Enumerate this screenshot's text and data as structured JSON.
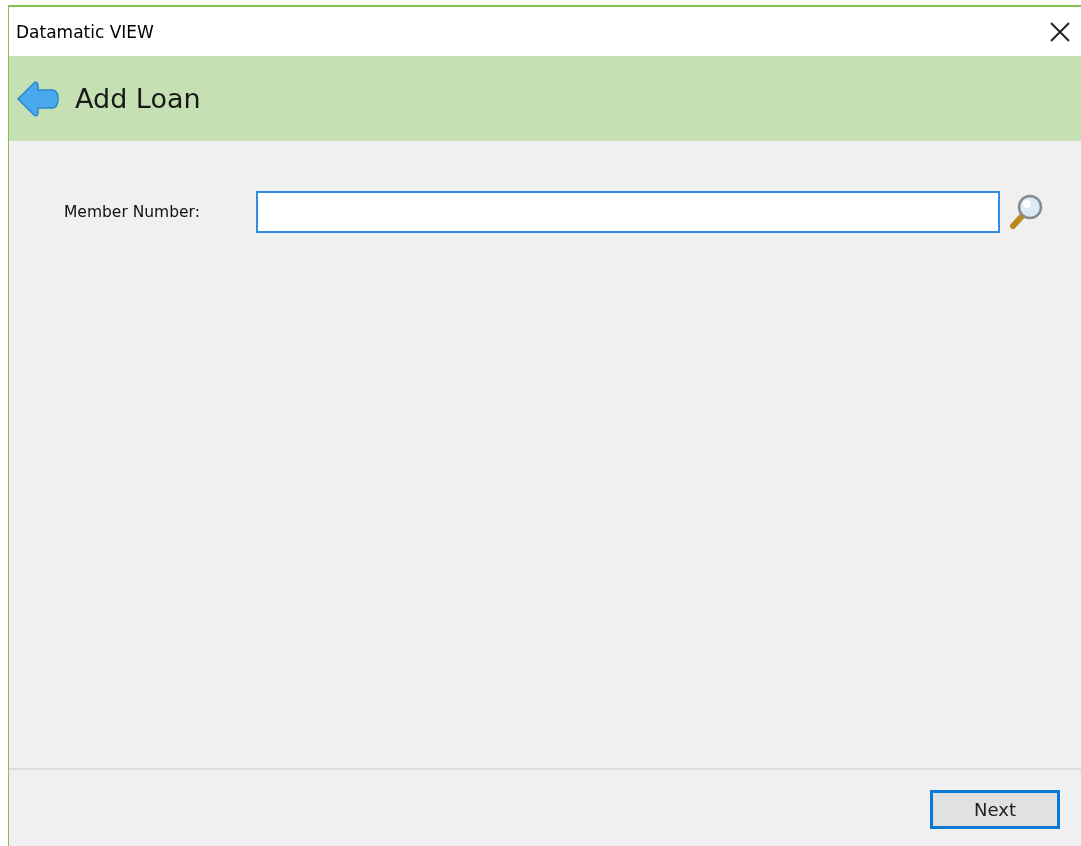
{
  "window": {
    "title": "Datamatic VIEW"
  },
  "header": {
    "title": "Add Loan"
  },
  "form": {
    "fields": [
      {
        "label": "Member Number:",
        "focused": true
      }
    ]
  },
  "buttons": [
    {
      "label": "Next",
      "default": true
    }
  ]
}
